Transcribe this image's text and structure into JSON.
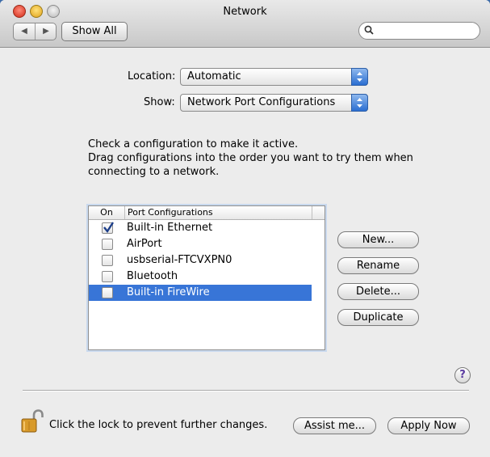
{
  "window": {
    "title": "Network"
  },
  "toolbar": {
    "show_all": "Show All",
    "search_placeholder": "",
    "search_value": ""
  },
  "location": {
    "label": "Location:",
    "value": "Automatic"
  },
  "show": {
    "label": "Show:",
    "value": "Network Port Configurations"
  },
  "instructions": [
    "Check a configuration to make it active.",
    "Drag configurations into the order you want to try them when",
    "connecting to a network."
  ],
  "table": {
    "columns": [
      "On",
      "Port Configurations"
    ],
    "rows": [
      {
        "label": "Built-in Ethernet",
        "checked": true,
        "selected": false
      },
      {
        "label": "AirPort",
        "checked": false,
        "selected": false
      },
      {
        "label": "usbserial-FTCVXPN0",
        "checked": false,
        "selected": false
      },
      {
        "label": "Bluetooth",
        "checked": false,
        "selected": false
      },
      {
        "label": "Built-in FireWire",
        "checked": false,
        "selected": true
      }
    ]
  },
  "buttons": {
    "new": "New...",
    "rename": "Rename",
    "delete": "Delete...",
    "duplicate": "Duplicate"
  },
  "help": "?",
  "footer": {
    "lock_text": "Click the lock to prevent further changes.",
    "assist": "Assist me...",
    "apply": "Apply Now"
  },
  "colors": {
    "selection": "#3875d7",
    "popup_arrow": "#2b6ed1",
    "desktop": "#3b6aa8"
  }
}
